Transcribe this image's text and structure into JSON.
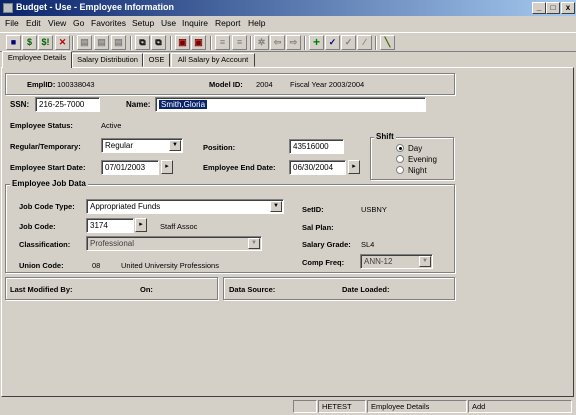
{
  "window": {
    "title": "Budget - Use - Employee Information",
    "min": "_",
    "max": "□",
    "close": "x"
  },
  "menu": [
    "File",
    "Edit",
    "View",
    "Go",
    "Favorites",
    "Setup",
    "Use",
    "Inquire",
    "Report",
    "Help"
  ],
  "tabs": [
    "Employee Details",
    "Salary Distribution",
    "OSE",
    "All Salary by Account"
  ],
  "header": {
    "emplid_label": "EmplID:",
    "emplid_value": "100338043",
    "model_label": "Model ID:",
    "model_value": "2004",
    "fiscal_year": "Fiscal Year 2003/2004"
  },
  "employee": {
    "ssn_label": "SSN:",
    "ssn_value": "216-25-7000",
    "name_label": "Name:",
    "name_value": "Smith,Gloria",
    "status_label": "Employee Status:",
    "status_value": "Active",
    "regular_label": "Regular/Temporary:",
    "regular_value": "Regular",
    "position_label": "Position:",
    "position_value": "43516000",
    "start_label": "Employee Start Date:",
    "start_value": "07/01/2003",
    "end_label": "Employee End Date:",
    "end_value": "06/30/2004"
  },
  "shift": {
    "title": "Shift",
    "options": [
      "Day",
      "Evening",
      "Night"
    ],
    "selected": "Day"
  },
  "jobdata": {
    "title": "Employee Job Data",
    "jobcodetype_label": "Job Code Type:",
    "jobcodetype_value": "Appropriated Funds",
    "setid_label": "SetID:",
    "setid_value": "USBNY",
    "jobcode_label": "Job Code:",
    "jobcode_value": "3174",
    "jobcode_desc": "Staff Assoc",
    "salplan_label": "Sal Plan:",
    "class_label": "Classification:",
    "class_value": "Professional",
    "grade_label": "Salary Grade:",
    "grade_value": "SL4",
    "union_label": "Union Code:",
    "union_code": "08",
    "union_name": "United University Professions",
    "compfreq_label": "Comp Freq:",
    "compfreq_value": "ANN-12"
  },
  "footer": {
    "lastmod_label": "Last Modified By:",
    "on_label": "On:",
    "datasource_label": "Data Source:",
    "dateloaded_label": "Date Loaded:"
  },
  "status": {
    "user": "HETEST",
    "page": "Employee Details",
    "mode": "Add"
  },
  "icons": [
    "save-icon",
    "money-icon",
    "money-alert-icon",
    "delete-icon",
    "grid1-icon",
    "grid2-icon",
    "grid3-icon",
    "copy-icon",
    "paste-icon",
    "search-icon",
    "zoom-icon",
    "list1-icon",
    "list2-icon",
    "settings-icon",
    "back-icon",
    "forward-icon",
    "add-icon",
    "check-icon",
    "check2-icon",
    "edit-icon",
    "pencil-icon"
  ]
}
